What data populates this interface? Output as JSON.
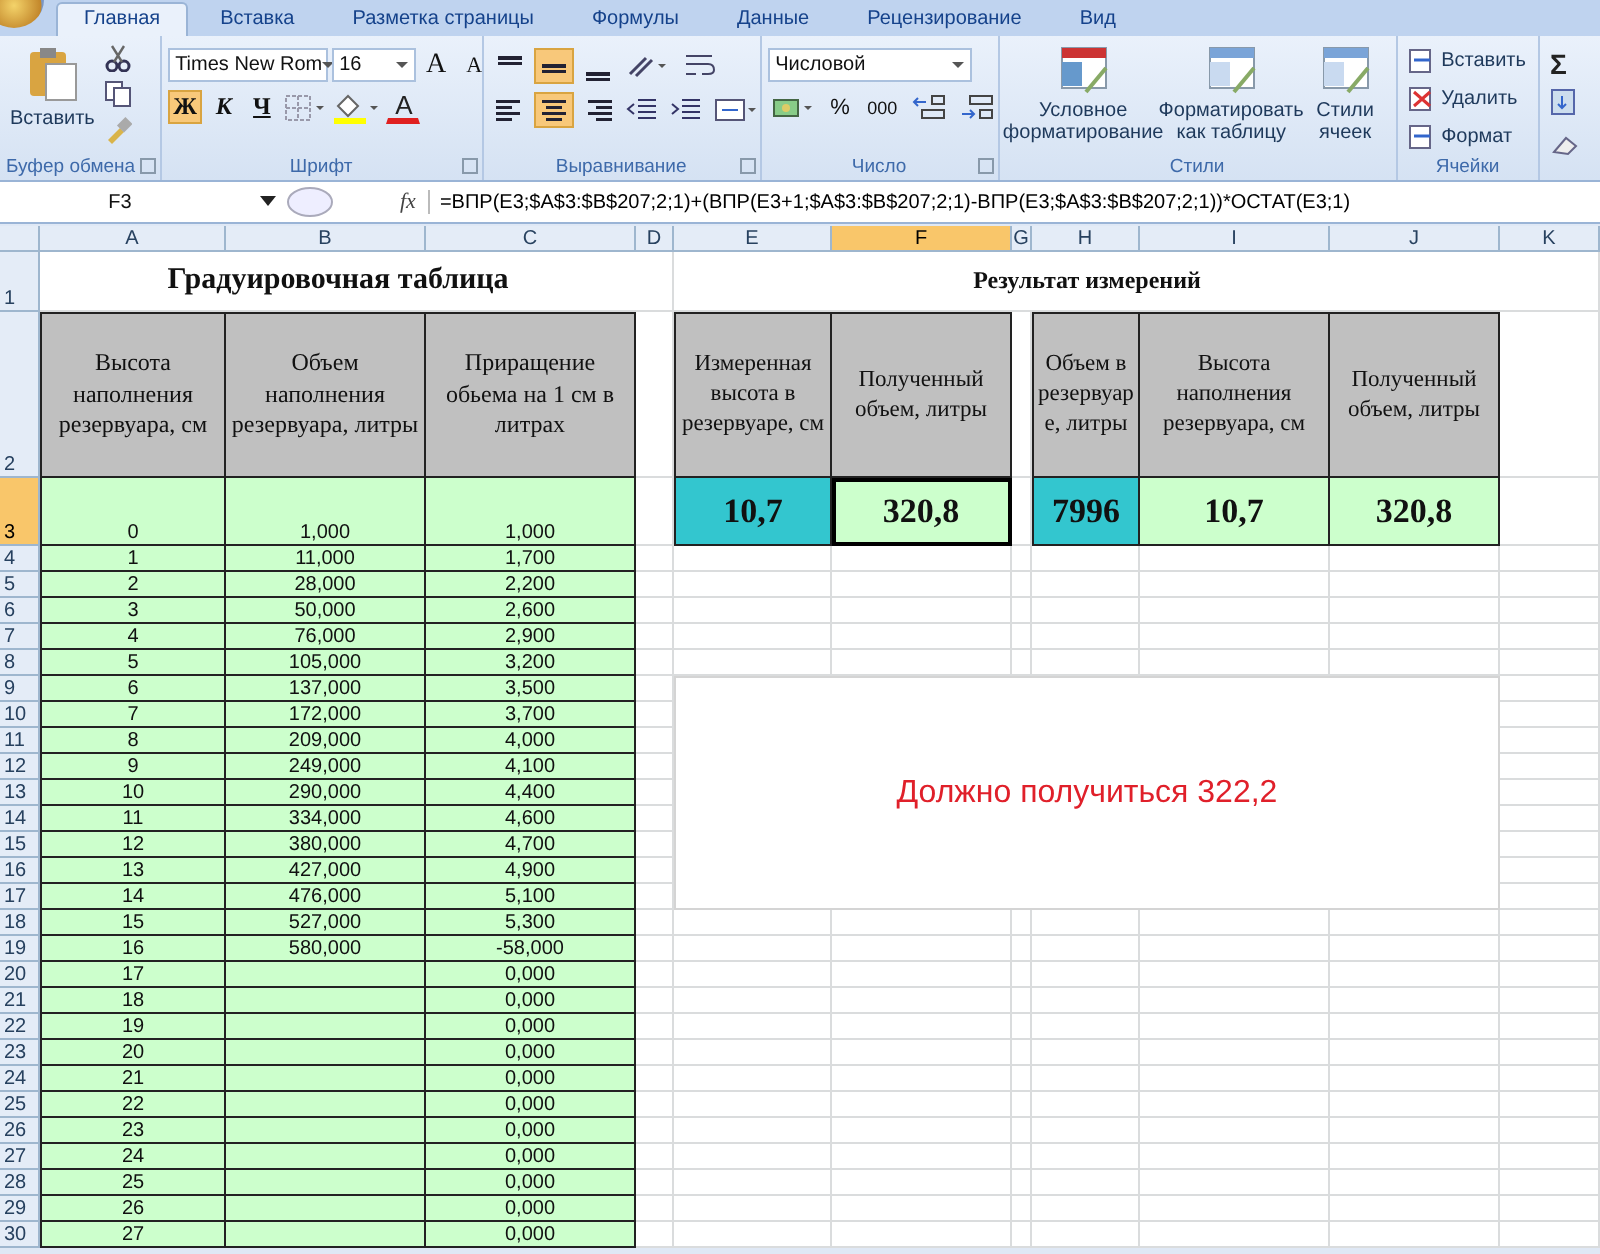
{
  "tabs": [
    {
      "label": "Главная",
      "selected": true
    },
    {
      "label": "Вставка",
      "selected": false
    },
    {
      "label": "Разметка страницы",
      "selected": false
    },
    {
      "label": "Формулы",
      "selected": false
    },
    {
      "label": "Данные",
      "selected": false
    },
    {
      "label": "Рецензирование",
      "selected": false
    },
    {
      "label": "Вид",
      "selected": false
    }
  ],
  "ribbon": {
    "clipboard": {
      "paste": "Вставить",
      "label": "Буфер обмена"
    },
    "font": {
      "name": "Times New Rom",
      "size": "16",
      "grow": "A",
      "shrink": "A",
      "color_letter": "A",
      "label": "Шрифт",
      "styles": [
        {
          "label": "Ж",
          "kind": "bold",
          "on": true
        },
        {
          "label": "К",
          "kind": "italic",
          "on": false
        },
        {
          "label": "Ч",
          "kind": "underline",
          "on": false
        }
      ]
    },
    "alignment": {
      "label": "Выравнивание",
      "vertical": [
        {
          "selected": false
        },
        {
          "selected": true
        },
        {
          "selected": false
        }
      ],
      "horizontal": [
        {
          "selected": false
        },
        {
          "selected": true
        },
        {
          "selected": false
        }
      ]
    },
    "number": {
      "format": "Числовой",
      "percent": "%",
      "thousands": "000",
      "label": "Число"
    },
    "styles": {
      "buttons": [
        "Условное форматирование",
        "Форматировать как таблицу",
        "Стили ячеек"
      ],
      "label": "Стили"
    },
    "cells": {
      "buttons": [
        "Вставить",
        "Удалить",
        "Формат"
      ],
      "label": "Ячейки"
    },
    "editing": {
      "sum": "Σ"
    }
  },
  "formula_bar": {
    "name_box": "F3",
    "fx": "fx",
    "formula": "=ВПР(E3;$A$3:$B$207;2;1)+(ВПР(E3+1;$A$3:$B$207;2;1)-ВПР(E3;$A$3:$B$207;2;1))*ОСТАТ(E3;1)"
  },
  "sheet": {
    "columns": [
      {
        "label": "A",
        "selected": false
      },
      {
        "label": "B",
        "selected": false
      },
      {
        "label": "C",
        "selected": false
      },
      {
        "label": "D",
        "selected": false
      },
      {
        "label": "E",
        "selected": false
      },
      {
        "label": "F",
        "selected": true
      },
      {
        "label": "G",
        "selected": false
      },
      {
        "label": "H",
        "selected": false
      },
      {
        "label": "I",
        "selected": false
      },
      {
        "label": "J",
        "selected": false
      },
      {
        "label": "K",
        "selected": false
      }
    ],
    "row_numbers": [
      {
        "label": "1",
        "selected": false
      },
      {
        "label": "2",
        "selected": false
      },
      {
        "label": "3",
        "selected": true
      },
      {
        "label": "4",
        "selected": false
      },
      {
        "label": "5",
        "selected": false
      },
      {
        "label": "6",
        "selected": false
      },
      {
        "label": "7",
        "selected": false
      },
      {
        "label": "8",
        "selected": false
      },
      {
        "label": "9",
        "selected": false
      },
      {
        "label": "10",
        "selected": false
      },
      {
        "label": "11",
        "selected": false
      },
      {
        "label": "12",
        "selected": false
      },
      {
        "label": "13",
        "selected": false
      },
      {
        "label": "14",
        "selected": false
      },
      {
        "label": "15",
        "selected": false
      },
      {
        "label": "16",
        "selected": false
      },
      {
        "label": "17",
        "selected": false
      },
      {
        "label": "18",
        "selected": false
      },
      {
        "label": "19",
        "selected": false
      },
      {
        "label": "20",
        "selected": false
      },
      {
        "label": "21",
        "selected": false
      },
      {
        "label": "22",
        "selected": false
      },
      {
        "label": "23",
        "selected": false
      },
      {
        "label": "24",
        "selected": false
      },
      {
        "label": "25",
        "selected": false
      },
      {
        "label": "26",
        "selected": false
      },
      {
        "label": "27",
        "selected": false
      },
      {
        "label": "28",
        "selected": false
      },
      {
        "label": "29",
        "selected": false
      },
      {
        "label": "30",
        "selected": false
      }
    ],
    "calibration": {
      "title": "Градуировочная таблица",
      "headers": [
        "Высота наполнения резервуара, см",
        "Объем наполнения резервуара, литры",
        "Приращение обьема на 1 см в литрах"
      ],
      "rows": [
        [
          "0",
          "1,000",
          "1,000"
        ],
        [
          "1",
          "11,000",
          "1,700"
        ],
        [
          "2",
          "28,000",
          "2,200"
        ],
        [
          "3",
          "50,000",
          "2,600"
        ],
        [
          "4",
          "76,000",
          "2,900"
        ],
        [
          "5",
          "105,000",
          "3,200"
        ],
        [
          "6",
          "137,000",
          "3,500"
        ],
        [
          "7",
          "172,000",
          "3,700"
        ],
        [
          "8",
          "209,000",
          "4,000"
        ],
        [
          "9",
          "249,000",
          "4,100"
        ],
        [
          "10",
          "290,000",
          "4,400"
        ],
        [
          "11",
          "334,000",
          "4,600"
        ],
        [
          "12",
          "380,000",
          "4,700"
        ],
        [
          "13",
          "427,000",
          "4,900"
        ],
        [
          "14",
          "476,000",
          "5,100"
        ],
        [
          "15",
          "527,000",
          "5,300"
        ],
        [
          "16",
          "580,000",
          "-58,000"
        ],
        [
          "17",
          null,
          "0,000"
        ],
        [
          "18",
          null,
          "0,000"
        ],
        [
          "19",
          null,
          "0,000"
        ],
        [
          "20",
          null,
          "0,000"
        ],
        [
          "21",
          null,
          "0,000"
        ],
        [
          "22",
          null,
          "0,000"
        ],
        [
          "23",
          null,
          "0,000"
        ],
        [
          "24",
          null,
          "0,000"
        ],
        [
          "25",
          null,
          "0,000"
        ],
        [
          "26",
          null,
          "0,000"
        ],
        [
          "27",
          null,
          "0,000"
        ]
      ]
    },
    "result": {
      "title": "Результат измерений",
      "blocks": [
        {
          "headers": [
            "Измеренная высота в резервуаре, см",
            "Полученный объем, литры"
          ],
          "values": [
            {
              "text": "10,7",
              "color": "#33c6cf"
            },
            {
              "text": "320,8",
              "color": "#ccffcc"
            }
          ]
        },
        {
          "headers": [
            "Объем в резервуаре, литры",
            "Высота наполнения резервуара, см",
            "Полученный объем, литры"
          ],
          "values": [
            {
              "text": "7996",
              "color": "#33c6cf"
            },
            {
              "text": "10,7",
              "color": "#ccffcc"
            },
            {
              "text": "320,8",
              "color": "#ccffcc"
            }
          ]
        }
      ]
    },
    "note": "Должно получиться 322,2"
  }
}
